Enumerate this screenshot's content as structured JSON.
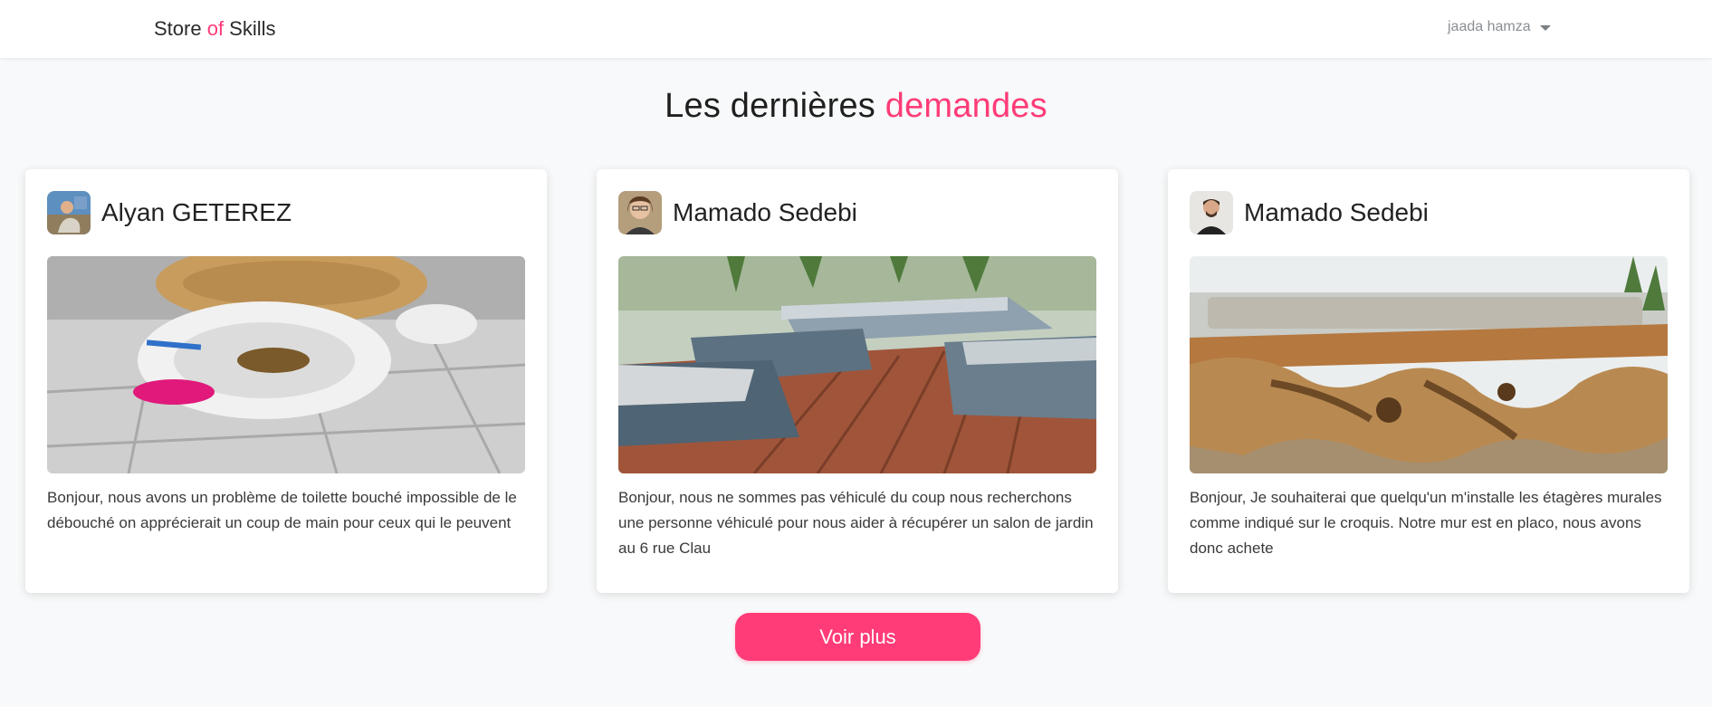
{
  "nav": {
    "brand_part1": "Store ",
    "brand_accent": "of",
    "brand_part2": " Skills",
    "user_name": "jaada hamza"
  },
  "heading": {
    "part1": "Les dernières ",
    "accent": "demandes"
  },
  "requests": [
    {
      "author": "Alyan GETEREZ",
      "text": "Bonjour, nous avons un problème de toilette bouché impossible de le débouché on apprécierait un coup de main pour ceux qui le peuvent"
    },
    {
      "author": "Mamado Sedebi",
      "text": "Bonjour, nous ne sommes pas véhiculé du coup nous recherchons une personne véhiculé pour nous aider à récupérer un salon de jardin au 6 rue Clau"
    },
    {
      "author": "Mamado Sedebi",
      "text": "Bonjour, Je souhaiterai que quelqu'un m'installe les étagères murales comme indiqué sur le croquis. Notre mur est en placo, nous avons donc achete"
    }
  ],
  "actions": {
    "more_label": "Voir plus"
  },
  "colors": {
    "accent": "#ff3c78",
    "background": "#f8f9fa"
  }
}
